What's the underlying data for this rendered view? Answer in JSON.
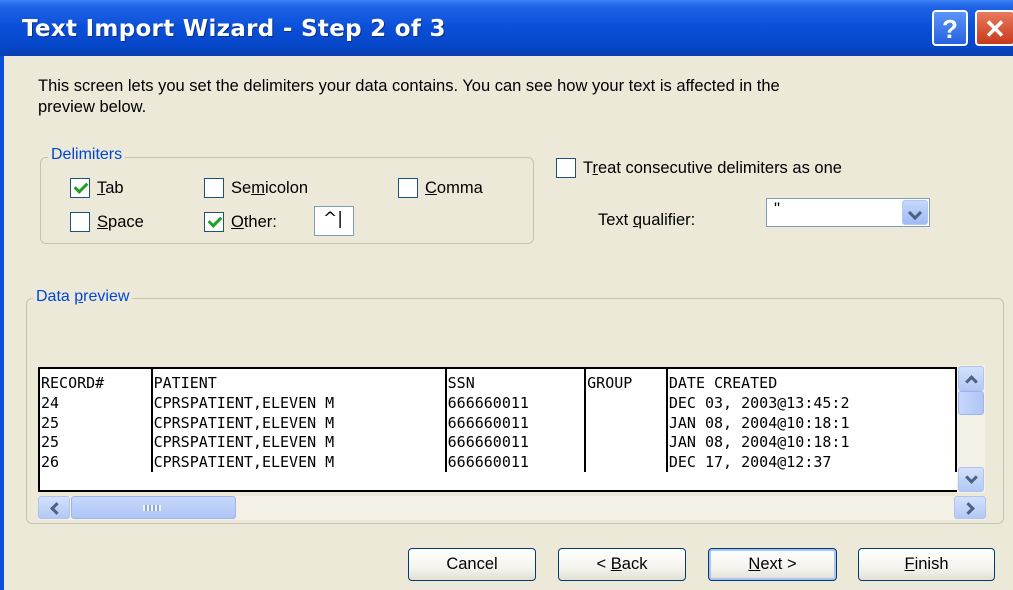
{
  "window": {
    "title": "Text Import Wizard - Step 2 of 3",
    "help_glyph": "?",
    "close_glyph": "✕"
  },
  "intro": "This screen lets you set the delimiters your data contains.  You can see how your text is affected in the preview below.",
  "delimiters": {
    "group_label": "Delimiters",
    "tab": {
      "label_m": "T",
      "label_rest": "ab",
      "checked": true
    },
    "semicolon": {
      "label_pre": "Se",
      "label_m": "m",
      "label_rest": "icolon",
      "checked": false
    },
    "comma": {
      "label_m": "C",
      "label_rest": "omma",
      "checked": false
    },
    "space": {
      "label_m": "S",
      "label_rest": "pace",
      "checked": false
    },
    "other": {
      "label_m": "O",
      "label_rest": "ther:",
      "checked": true,
      "value": "^|"
    }
  },
  "consecutive": {
    "label_pre": "T",
    "label_m": "r",
    "label_rest": "eat consecutive delimiters as one",
    "checked": false
  },
  "qualifier": {
    "label_pre": "Text ",
    "label_m": "q",
    "label_rest": "ualifier:",
    "value": "\""
  },
  "preview": {
    "group_label_pre": "Data ",
    "group_label_m": "p",
    "group_label_rest": "review",
    "rows": [
      [
        "RECORD#",
        "PATIENT",
        "SSN",
        "GROUP",
        "DATE CREATED"
      ],
      [
        "24",
        "CPRSPATIENT,ELEVEN M",
        "666660011",
        "",
        "DEC 03, 2003@13:45:2"
      ],
      [
        "25",
        "CPRSPATIENT,ELEVEN M",
        "666660011",
        "",
        "JAN 08, 2004@10:18:1"
      ],
      [
        "25",
        "CPRSPATIENT,ELEVEN M",
        "666660011",
        "",
        "JAN 08, 2004@10:18:1"
      ],
      [
        "26",
        "CPRSPATIENT,ELEVEN M",
        "666660011",
        "",
        "DEC 17, 2004@12:37"
      ]
    ]
  },
  "buttons": {
    "cancel": "Cancel",
    "back_pre": "< ",
    "back_m": "B",
    "back_rest": "ack",
    "next_m": "N",
    "next_rest": "ext >",
    "finish_m": "F",
    "finish_rest": "inish"
  }
}
